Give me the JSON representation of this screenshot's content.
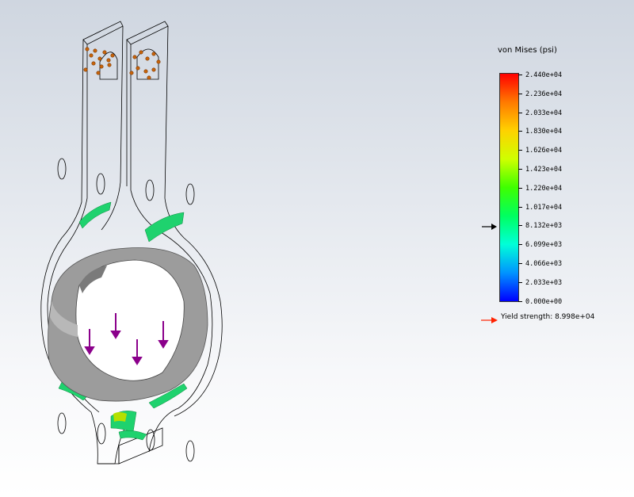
{
  "legend": {
    "title": "von Mises (psi)",
    "ticks": [
      "2.440e+04",
      "2.236e+04",
      "2.033e+04",
      "1.830e+04",
      "1.626e+04",
      "1.423e+04",
      "1.220e+04",
      "1.017e+04",
      "8.132e+03",
      "6.099e+03",
      "4.066e+03",
      "2.033e+03",
      "0.000e+00"
    ],
    "colors": [
      "#ff0000",
      "#ff7a00",
      "#ffd200",
      "#cfff00",
      "#3fff00",
      "#00ff60",
      "#00ffd8",
      "#0094ff",
      "#0000ff"
    ],
    "yield_label": "Yield strength: 8.998e+04",
    "yield_marker_color": "#000000",
    "yield_arrow_color": "#ff2200"
  },
  "model": {
    "body_outline_color": "#000000",
    "bearing_color": "#a6a6a6",
    "fixture_color": "#c8640a",
    "load_arrow_color": "#8b008b",
    "low_stress_color": "#1fd26e"
  }
}
